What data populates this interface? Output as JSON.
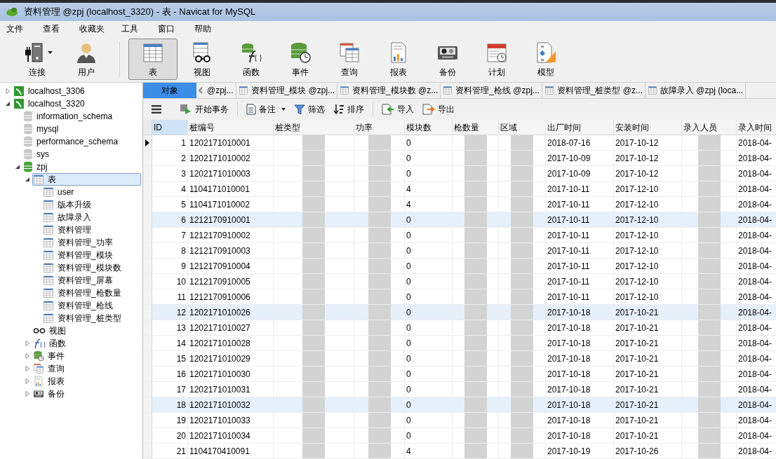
{
  "window": {
    "title": "资料管理 @zpj (localhost_3320) - 表 - Navicat for MySQL"
  },
  "menu": [
    "文件",
    "查看",
    "收藏夹",
    "工具",
    "窗口",
    "帮助"
  ],
  "toolbar": [
    {
      "kind": "connect",
      "label": "连接",
      "selected": false
    },
    {
      "kind": "user",
      "label": "用户",
      "selected": false
    },
    {
      "kind": "table",
      "label": "表",
      "selected": true
    },
    {
      "kind": "view",
      "label": "视图",
      "selected": false
    },
    {
      "kind": "function",
      "label": "函数",
      "selected": false
    },
    {
      "kind": "event",
      "label": "事件",
      "selected": false
    },
    {
      "kind": "query",
      "label": "查询",
      "selected": false
    },
    {
      "kind": "report",
      "label": "报表",
      "selected": false
    },
    {
      "kind": "backup",
      "label": "备份",
      "selected": false
    },
    {
      "kind": "schedule",
      "label": "计划",
      "selected": false
    },
    {
      "kind": "model",
      "label": "模型",
      "selected": false
    }
  ],
  "sidebar": {
    "items": [
      {
        "kind": "server",
        "label": "localhost_3306",
        "expanded": false,
        "selected": false
      },
      {
        "kind": "server",
        "label": "localhost_3320",
        "expanded": true,
        "selected": false,
        "children": [
          {
            "kind": "db",
            "label": "information_schema",
            "selected": false
          },
          {
            "kind": "db",
            "label": "mysql",
            "selected": false
          },
          {
            "kind": "db",
            "label": "performance_schema",
            "selected": false
          },
          {
            "kind": "db",
            "label": "sys",
            "selected": false
          },
          {
            "kind": "db_open",
            "label": "zpj",
            "expanded": true,
            "selected": false,
            "children": [
              {
                "kind": "table",
                "label": "表",
                "expanded": true,
                "selected": true,
                "children": [
                  {
                    "kind": "table",
                    "label": "user",
                    "selected": false
                  },
                  {
                    "kind": "table",
                    "label": "版本升级",
                    "selected": false
                  },
                  {
                    "kind": "table",
                    "label": "故障录入",
                    "selected": false
                  },
                  {
                    "kind": "table",
                    "label": "资料管理",
                    "selected": false
                  },
                  {
                    "kind": "table",
                    "label": "资料管理_功率",
                    "selected": false
                  },
                  {
                    "kind": "table",
                    "label": "资料管理_模块",
                    "selected": false
                  },
                  {
                    "kind": "table",
                    "label": "资料管理_模块数",
                    "selected": false
                  },
                  {
                    "kind": "table",
                    "label": "资料管理_屏幕",
                    "selected": false
                  },
                  {
                    "kind": "table",
                    "label": "资料管理_枪数量",
                    "selected": false
                  },
                  {
                    "kind": "table",
                    "label": "资料管理_枪线",
                    "selected": false
                  },
                  {
                    "kind": "table",
                    "label": "资料管理_桩类型",
                    "selected": false
                  }
                ]
              },
              {
                "kind": "view",
                "label": "视图",
                "selected": false
              },
              {
                "kind": "function",
                "label": "函数",
                "expanded": false,
                "selected": false
              },
              {
                "kind": "event",
                "label": "事件",
                "expanded": false,
                "selected": false
              },
              {
                "kind": "query",
                "label": "查询",
                "expanded": false,
                "selected": false
              },
              {
                "kind": "report",
                "label": "报表",
                "expanded": false,
                "selected": false
              },
              {
                "kind": "backup",
                "label": "备份",
                "expanded": false,
                "selected": false
              }
            ]
          }
        ]
      }
    ]
  },
  "tabs": [
    {
      "label": "对象",
      "selected": true,
      "icon": false
    },
    {
      "label": "@zpj...",
      "selected": false,
      "icon": false
    },
    {
      "label": "资料管理_模块 @zpj...",
      "selected": false,
      "icon": true
    },
    {
      "label": "资料管理_模块数 @z...",
      "selected": false,
      "icon": true
    },
    {
      "label": "资料管理_枪线 @zpj...",
      "selected": false,
      "icon": true
    },
    {
      "label": "资料管理_桩类型 @z...",
      "selected": false,
      "icon": true
    },
    {
      "label": "故障录入 @zpj (loca...",
      "selected": false,
      "icon": true
    }
  ],
  "grid_toolbar": [
    {
      "kind": "transaction",
      "label": "开始事务"
    },
    {
      "kind": "memo",
      "label": "备注"
    },
    {
      "kind": "filter",
      "label": "筛选"
    },
    {
      "kind": "sort",
      "label": "排序"
    },
    {
      "kind": "import",
      "label": "导入"
    },
    {
      "kind": "export",
      "label": "导出"
    }
  ],
  "table": {
    "columns": [
      {
        "label": "ID"
      },
      {
        "label": "桩编号"
      },
      {
        "label": "桩类型"
      },
      {
        "label": "功率"
      },
      {
        "label": "模块数"
      },
      {
        "label": "枪数量"
      },
      {
        "label": "区域"
      },
      {
        "label": "出厂时间"
      },
      {
        "label": "安装时间"
      },
      {
        "label": "录入人员"
      },
      {
        "label": "录入时间"
      }
    ],
    "rows": [
      {
        "selected": true,
        "highlighted": false,
        "cells": [
          "1",
          "1202171010001",
          null,
          null,
          "0",
          null,
          null,
          "2018-07-16",
          "2017-10-12",
          null,
          "2018-04-"
        ]
      },
      {
        "selected": false,
        "highlighted": false,
        "cells": [
          "2",
          "1202171010002",
          null,
          null,
          "0",
          null,
          null,
          "2017-10-09",
          "2017-10-12",
          null,
          "2018-04-"
        ]
      },
      {
        "selected": false,
        "highlighted": false,
        "cells": [
          "3",
          "1202171010003",
          null,
          null,
          "0",
          null,
          null,
          "2017-10-09",
          "2017-10-12",
          null,
          "2018-04-"
        ]
      },
      {
        "selected": false,
        "highlighted": false,
        "cells": [
          "4",
          "1104171010001",
          null,
          null,
          "4",
          null,
          null,
          "2017-10-11",
          "2017-12-10",
          null,
          "2018-04-"
        ]
      },
      {
        "selected": false,
        "highlighted": false,
        "cells": [
          "5",
          "1104171010002",
          null,
          null,
          "4",
          null,
          null,
          "2017-10-11",
          "2017-12-10",
          null,
          "2018-04-"
        ]
      },
      {
        "selected": false,
        "highlighted": true,
        "cells": [
          "6",
          "1212170910001",
          null,
          null,
          "0",
          null,
          null,
          "2017-10-11",
          "2017-12-10",
          null,
          "2018-04-"
        ]
      },
      {
        "selected": false,
        "highlighted": false,
        "cells": [
          "7",
          "1212170910002",
          null,
          null,
          "0",
          null,
          null,
          "2017-10-11",
          "2017-12-10",
          null,
          "2018-04-"
        ]
      },
      {
        "selected": false,
        "highlighted": false,
        "cells": [
          "8",
          "1212170910003",
          null,
          null,
          "0",
          null,
          null,
          "2017-10-11",
          "2017-12-10",
          null,
          "2018-04-"
        ]
      },
      {
        "selected": false,
        "highlighted": false,
        "cells": [
          "9",
          "1212170910004",
          null,
          null,
          "0",
          null,
          null,
          "2017-10-11",
          "2017-12-10",
          null,
          "2018-04-"
        ]
      },
      {
        "selected": false,
        "highlighted": false,
        "cells": [
          "10",
          "1212170910005",
          null,
          null,
          "0",
          null,
          null,
          "2017-10-11",
          "2017-12-10",
          null,
          "2018-04-"
        ]
      },
      {
        "selected": false,
        "highlighted": false,
        "cells": [
          "11",
          "1212170910006",
          null,
          null,
          "0",
          null,
          null,
          "2017-10-11",
          "2017-12-10",
          null,
          "2018-04-"
        ]
      },
      {
        "selected": false,
        "highlighted": true,
        "cells": [
          "12",
          "1202171010026",
          null,
          null,
          "0",
          null,
          null,
          "2017-10-18",
          "2017-10-21",
          null,
          "2018-04-"
        ]
      },
      {
        "selected": false,
        "highlighted": false,
        "cells": [
          "13",
          "1202171010027",
          null,
          null,
          "0",
          null,
          null,
          "2017-10-18",
          "2017-10-21",
          null,
          "2018-04-"
        ]
      },
      {
        "selected": false,
        "highlighted": false,
        "cells": [
          "14",
          "1202171010028",
          null,
          null,
          "0",
          null,
          null,
          "2017-10-18",
          "2017-10-21",
          null,
          "2018-04-"
        ]
      },
      {
        "selected": false,
        "highlighted": false,
        "cells": [
          "15",
          "1202171010029",
          null,
          null,
          "0",
          null,
          null,
          "2017-10-18",
          "2017-10-21",
          null,
          "2018-04-"
        ]
      },
      {
        "selected": false,
        "highlighted": false,
        "cells": [
          "16",
          "1202171010030",
          null,
          null,
          "0",
          null,
          null,
          "2017-10-18",
          "2017-10-21",
          null,
          "2018-04-"
        ]
      },
      {
        "selected": false,
        "highlighted": false,
        "cells": [
          "17",
          "1202171010031",
          null,
          null,
          "0",
          null,
          null,
          "2017-10-18",
          "2017-10-21",
          null,
          "2018-04-"
        ]
      },
      {
        "selected": false,
        "highlighted": true,
        "cells": [
          "18",
          "1202171010032",
          null,
          null,
          "0",
          null,
          null,
          "2017-10-18",
          "2017-10-21",
          null,
          "2018-04-"
        ]
      },
      {
        "selected": false,
        "highlighted": false,
        "cells": [
          "19",
          "1202171010033",
          null,
          null,
          "0",
          null,
          null,
          "2017-10-18",
          "2017-10-21",
          null,
          "2018-04-"
        ]
      },
      {
        "selected": false,
        "highlighted": false,
        "cells": [
          "20",
          "1202171010034",
          null,
          null,
          "0",
          null,
          null,
          "2017-10-18",
          "2017-10-21",
          null,
          "2018-04-"
        ]
      },
      {
        "selected": false,
        "highlighted": false,
        "cells": [
          "21",
          "1104170410091",
          null,
          null,
          "4",
          null,
          null,
          "2017-10-19",
          "2017-10-26",
          null,
          "2018-04-"
        ]
      }
    ]
  }
}
